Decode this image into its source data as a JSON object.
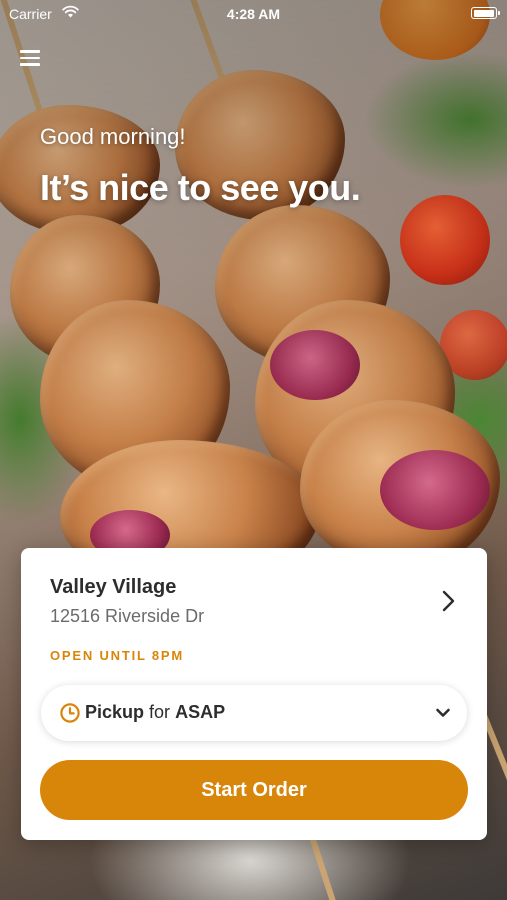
{
  "status_bar": {
    "carrier": "Carrier",
    "time": "4:28 AM",
    "battery_level": 1.0
  },
  "hero": {
    "greeting": "Good morning!",
    "headline": "It’s nice to see you."
  },
  "location_card": {
    "store_name": "Valley Village",
    "address": "12516 Riverside Dr",
    "hours": "OPEN UNTIL 8PM",
    "order_type": "Pickup",
    "order_connector": "for",
    "order_time": "ASAP",
    "start_button_label": "Start Order"
  },
  "colors": {
    "accent": "#d8860a",
    "card_bg": "#ffffff",
    "text_primary": "#2d2d2d",
    "text_secondary": "#6b6b6b"
  },
  "icons": [
    "wifi-icon",
    "battery-icon",
    "hamburger-menu-icon",
    "chevron-right-icon",
    "clock-icon",
    "chevron-down-icon"
  ]
}
